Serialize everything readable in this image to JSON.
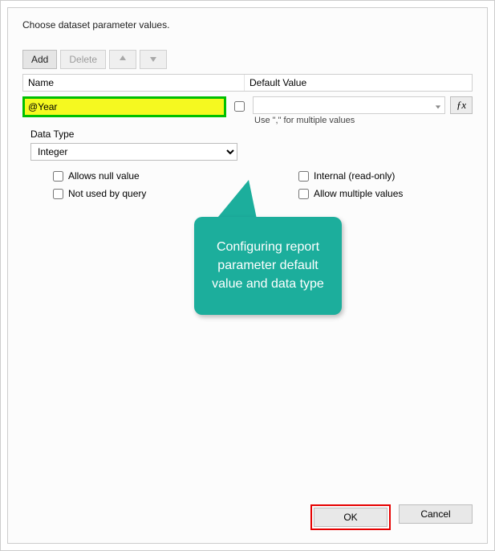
{
  "dialog": {
    "title": "Choose dataset parameter values."
  },
  "toolbar": {
    "add": "Add",
    "delete": "Delete"
  },
  "grid": {
    "name_header": "Name",
    "default_header": "Default Value"
  },
  "param": {
    "name_value": "@Year",
    "default_value": "",
    "default_hint": "Use \",\" for multiple values"
  },
  "datatype": {
    "label": "Data Type",
    "value": "Integer"
  },
  "options": {
    "allows_null": "Allows null value",
    "not_used": "Not used by query",
    "internal": "Internal (read-only)",
    "allow_multi": "Allow multiple values"
  },
  "callout": {
    "text": "Configuring report parameter default value and data type"
  },
  "buttons": {
    "ok": "OK",
    "cancel": "Cancel"
  }
}
